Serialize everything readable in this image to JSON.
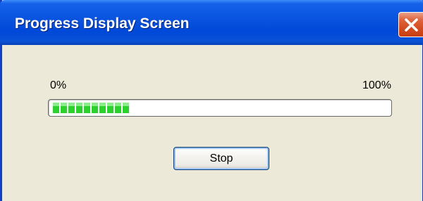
{
  "window": {
    "title": "Progress Display Screen",
    "close_icon": "close-icon"
  },
  "progress": {
    "min_label": "0%",
    "max_label": "100%",
    "value_fraction": 0.23,
    "fill_color": "#2bd22b"
  },
  "actions": {
    "stop_label": "Stop"
  },
  "colors": {
    "titlebar": "#0a54e0",
    "window_bg": "#ece9d8",
    "close_button": "#d24a1e"
  }
}
